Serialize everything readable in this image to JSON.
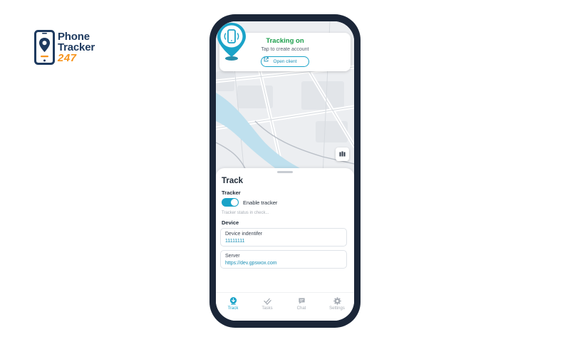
{
  "logo": {
    "line1": "Phone",
    "line2": "Tracker",
    "line3": "247",
    "icon": "map-pin-phone-icon"
  },
  "map": {
    "status_title": "Tracking on",
    "status_subtitle": "Tap to create account",
    "open_client_label": "Open client",
    "open_client_icon": "external-link-icon",
    "layers_icon": "map-layers-icon",
    "pin_icon": "phone-vibrate-pin-icon"
  },
  "sheet": {
    "title": "Track",
    "tracker_section": "Tracker",
    "enable_tracker_label": "Enable tracker",
    "enable_tracker_on": true,
    "tracker_status": "Tracker status in check...",
    "device_section": "Device",
    "fields": [
      {
        "label": "Device indentifer",
        "value": "11111111"
      },
      {
        "label": "Server",
        "value": "https://dev.gpswox.com"
      }
    ]
  },
  "tabs": [
    {
      "label": "Track",
      "icon": "track-icon",
      "active": true
    },
    {
      "label": "Tasks",
      "icon": "double-check-icon",
      "active": false
    },
    {
      "label": "Chat",
      "icon": "chat-icon",
      "active": false
    },
    {
      "label": "Settings",
      "icon": "gear-icon",
      "active": false
    }
  ],
  "colors": {
    "accent": "#1aa3c8",
    "tracking_green": "#1b9e4b",
    "logo_navy": "#1e3a5f",
    "logo_orange": "#f7941d",
    "phone_frame": "#1b2638",
    "river": "#bfe0ee"
  }
}
